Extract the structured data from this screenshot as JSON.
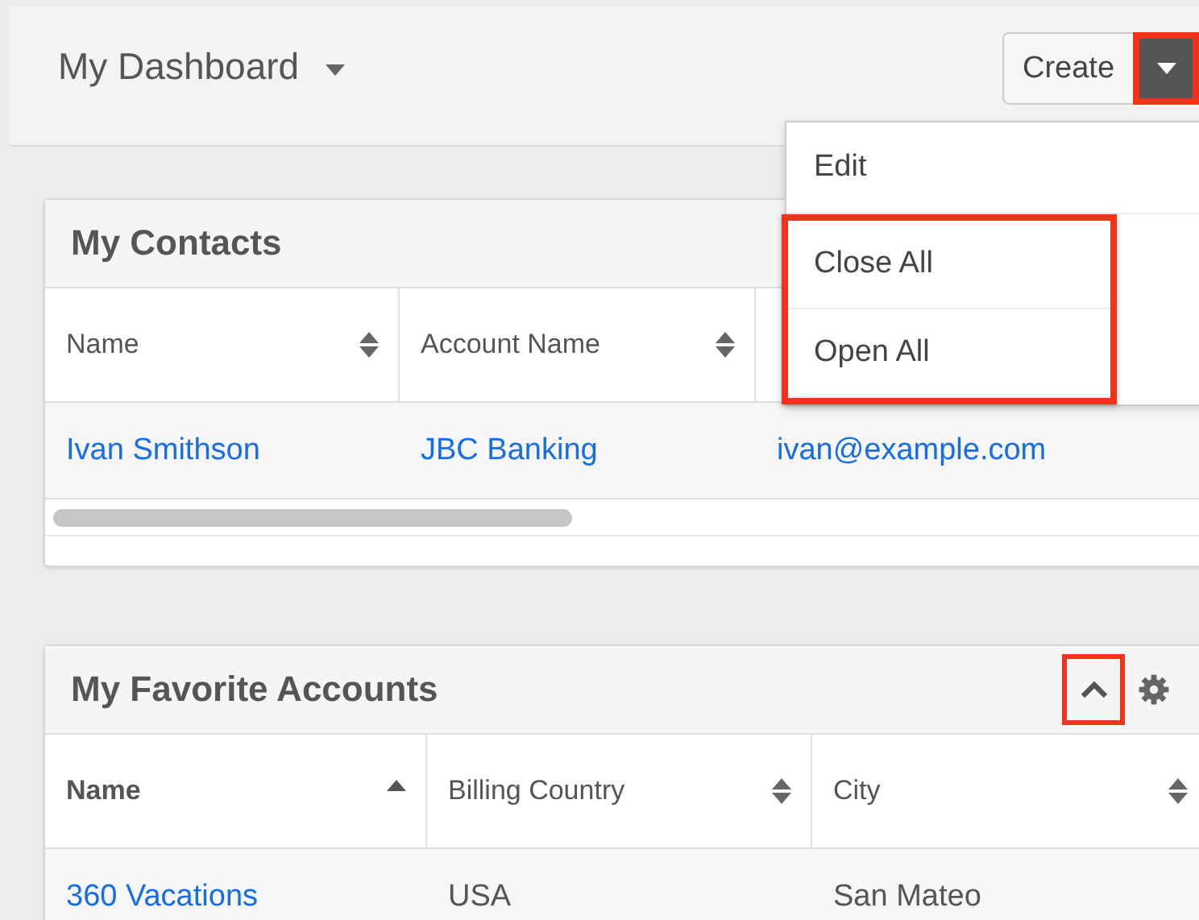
{
  "header": {
    "title": "My Dashboard",
    "create_label": "Create",
    "toggle_highlighted": true
  },
  "menu": {
    "items": [
      {
        "label": "Edit",
        "highlighted": false
      },
      {
        "label": "Close All",
        "highlighted": true
      },
      {
        "label": "Open All",
        "highlighted": true
      }
    ]
  },
  "dashlets": [
    {
      "title": "My Contacts",
      "columns": [
        {
          "label": "Name",
          "sorted": false
        },
        {
          "label": "Account Name",
          "sorted": false
        }
      ],
      "rows": [
        [
          {
            "text": "Ivan Smithson",
            "link": true
          },
          {
            "text": "JBC Banking",
            "link": true
          },
          {
            "text": "ivan@example.com",
            "link": true
          }
        ]
      ]
    },
    {
      "title": "My Favorite Accounts",
      "collapse_highlighted": true,
      "columns": [
        {
          "label": "Name",
          "sorted": true
        },
        {
          "label": "Billing Country",
          "sorted": false
        },
        {
          "label": "City",
          "sorted": false
        }
      ],
      "rows": [
        [
          {
            "text": "360 Vacations",
            "link": true
          },
          {
            "text": "USA",
            "link": false
          },
          {
            "text": "San Mateo",
            "link": false
          }
        ]
      ]
    }
  ]
}
